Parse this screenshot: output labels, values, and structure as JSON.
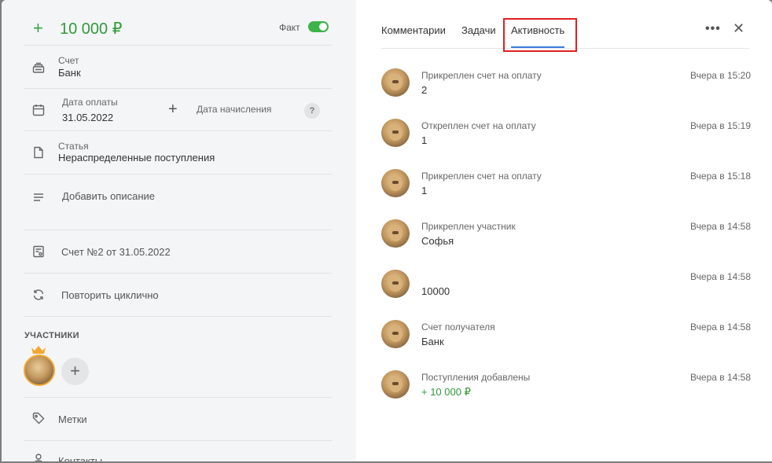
{
  "header": {
    "plus": "+",
    "amount": "10 000 ₽",
    "fact_label": "Факт"
  },
  "fields": {
    "account_label": "Счет",
    "account_value": "Банк",
    "pay_date_label": "Дата оплаты",
    "pay_date_value": "31.05.2022",
    "accrual_label": "Дата начисления",
    "help": "?",
    "article_label": "Статья",
    "article_value": "Нераспределенные поступления",
    "description": "Добавить описание",
    "invoice": "Счет №2 от 31.05.2022",
    "repeat": "Повторить циклично",
    "tags": "Метки",
    "contacts": "Контакты"
  },
  "participants": {
    "title": "УЧАСТНИКИ",
    "add": "+"
  },
  "tabs": {
    "comments": "Комментарии",
    "tasks": "Задачи",
    "activity": "Активность",
    "more": "•••",
    "close": "✕"
  },
  "activities": [
    {
      "title": "Прикреплен счет на оплату",
      "value": "2",
      "time": "Вчера в 15:20"
    },
    {
      "title": "Откреплен счет на оплату",
      "value": "1",
      "time": "Вчера в 15:19"
    },
    {
      "title": "Прикреплен счет на оплату",
      "value": "1",
      "time": "Вчера в 15:18"
    },
    {
      "title": "Прикреплен участник",
      "value": "Софья",
      "time": "Вчера в 14:58"
    },
    {
      "title": "",
      "value": "10000",
      "time": "Вчера в 14:58"
    },
    {
      "title": "Счет получателя",
      "value": "Банк",
      "time": "Вчера в 14:58"
    },
    {
      "title": "Поступления добавлены",
      "value": "+ 10 000 ₽",
      "time": "Вчера в 14:58"
    }
  ],
  "colors": {
    "accent_green": "#2f9a3a",
    "tab_underline": "#3d7ce0",
    "highlight_red": "#e02020"
  }
}
